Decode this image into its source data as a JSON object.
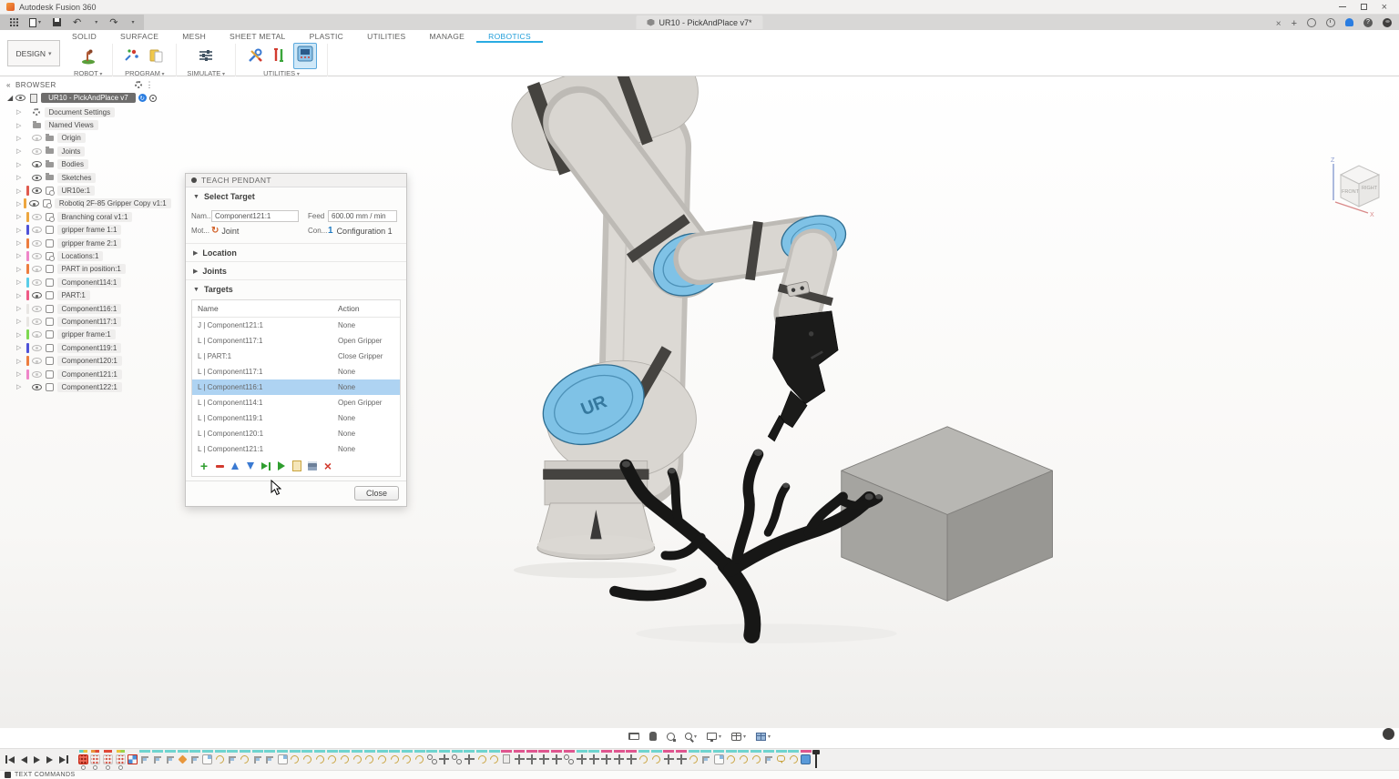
{
  "titlebar": {
    "app_title": "Autodesk Fusion 360"
  },
  "tabbar": {
    "document_tab": "UR10 - PickAndPlace v7*"
  },
  "ribbon": {
    "workspace_label": "DESIGN",
    "tabs": [
      {
        "label": "SOLID"
      },
      {
        "label": "SURFACE"
      },
      {
        "label": "MESH"
      },
      {
        "label": "SHEET METAL"
      },
      {
        "label": "PLASTIC"
      },
      {
        "label": "UTILITIES"
      },
      {
        "label": "MANAGE"
      },
      {
        "label": "ROBOTICS",
        "active": true
      }
    ],
    "groups": [
      {
        "label": "ROBOT"
      },
      {
        "label": "PROGRAM"
      },
      {
        "label": "SIMULATE"
      },
      {
        "label": "UTILITIES"
      }
    ]
  },
  "browser": {
    "header": "BROWSER",
    "root_label": "UR10 - PickAndPlace v7",
    "items": [
      {
        "label": "Document Settings",
        "icon": "gear",
        "eye": "none",
        "color": null
      },
      {
        "label": "Named Views",
        "icon": "folder",
        "eye": "none",
        "color": null
      },
      {
        "label": "Origin",
        "icon": "folder",
        "eye": "hidden",
        "color": null
      },
      {
        "label": "Joints",
        "icon": "folder",
        "eye": "hidden",
        "color": null
      },
      {
        "label": "Bodies",
        "icon": "folder",
        "eye": "visible",
        "color": null
      },
      {
        "label": "Sketches",
        "icon": "folder",
        "eye": "visible",
        "color": null
      },
      {
        "label": "UR10e:1",
        "icon": "link",
        "eye": "visible",
        "color": "#e05a4e"
      },
      {
        "label": "Robotiq 2F-85 Gripper Copy v1:1",
        "icon": "link",
        "eye": "visible",
        "color": "#eda63f"
      },
      {
        "label": "Branching coral v1:1",
        "icon": "link",
        "eye": "hidden",
        "color": "#eda63f"
      },
      {
        "label": "gripper frame 1:1",
        "icon": "comp",
        "eye": "hidden",
        "color": "#4f52d8"
      },
      {
        "label": "gripper frame 2:1",
        "icon": "comp",
        "eye": "hidden",
        "color": "#ed7d3f"
      },
      {
        "label": "Locations:1",
        "icon": "link",
        "eye": "hidden",
        "color": "#ef86c9"
      },
      {
        "label": "PART in position:1",
        "icon": "comp",
        "eye": "hidden",
        "color": "#ed7d3f"
      },
      {
        "label": "Component114:1",
        "icon": "comp",
        "eye": "hidden",
        "color": "#59cde8"
      },
      {
        "label": "PART:1",
        "icon": "comp",
        "eye": "visible",
        "color": "#ef5a86"
      },
      {
        "label": "Component116:1",
        "icon": "comp",
        "eye": "hidden",
        "color": "#e8e6e3"
      },
      {
        "label": "Component117:1",
        "icon": "comp",
        "eye": "hidden",
        "color": "#e8e6e3"
      },
      {
        "label": "gripper frame:1",
        "icon": "comp",
        "eye": "hidden",
        "color": "#7ed952"
      },
      {
        "label": "Component119:1",
        "icon": "comp",
        "eye": "hidden",
        "color": "#4f52d8"
      },
      {
        "label": "Component120:1",
        "icon": "comp",
        "eye": "hidden",
        "color": "#ed7d3f"
      },
      {
        "label": "Component121:1",
        "icon": "comp",
        "eye": "hidden",
        "color": "#ef86c9"
      },
      {
        "label": "Component122:1",
        "icon": "comp",
        "eye": "visible",
        "color": null
      }
    ]
  },
  "viewcube": {
    "front": "FRONT",
    "right": "RIGHT",
    "z": "Z",
    "x": "X"
  },
  "dialog": {
    "title": "TEACH PENDANT",
    "select_target_label": "Select Target",
    "fields": {
      "name_label": "Nam...",
      "name_value": "Component121:1",
      "feed_label": "Feed",
      "feed_value": "600.00 mm / min",
      "motion_label": "Mot...",
      "motion_value": "Joint",
      "config_label": "Con...",
      "config_badge": "1",
      "config_value": "Configuration 1"
    },
    "location_label": "Location",
    "joints_label": "Joints",
    "targets_label": "Targets",
    "table": {
      "columns": [
        "Name",
        "Action"
      ],
      "rows": [
        {
          "name": "J | Component121:1",
          "action": "None"
        },
        {
          "name": "L | Component117:1",
          "action": "Open Gripper"
        },
        {
          "name": "L | PART:1",
          "action": "Close Gripper"
        },
        {
          "name": "L | Component117:1",
          "action": "None"
        },
        {
          "name": "L | Component116:1",
          "action": "None",
          "selected": true
        },
        {
          "name": "L | Component114:1",
          "action": "Open Gripper"
        },
        {
          "name": "L | Component119:1",
          "action": "None"
        },
        {
          "name": "L | Component120:1",
          "action": "None"
        },
        {
          "name": "L | Component121:1",
          "action": "None"
        }
      ]
    },
    "toolbar": [
      {
        "name": "add-target",
        "type": "add"
      },
      {
        "name": "remove-target",
        "type": "remove"
      },
      {
        "name": "move-target-up",
        "type": "up"
      },
      {
        "name": "move-target-down",
        "type": "down"
      },
      {
        "name": "step-to-target",
        "type": "step"
      },
      {
        "name": "play-targets",
        "type": "play"
      },
      {
        "name": "copy-target",
        "type": "copy"
      },
      {
        "name": "save-targets",
        "type": "save"
      },
      {
        "name": "delete-all-targets",
        "type": "delete"
      }
    ],
    "close_label": "Close"
  },
  "navbar": {
    "icons": [
      {
        "name": "view-capture",
        "drop": false
      },
      {
        "name": "pan-hand",
        "drop": false
      },
      {
        "name": "orbit",
        "drop": false
      },
      {
        "name": "zoom",
        "drop": true
      },
      {
        "name": "display-settings",
        "drop": true
      },
      {
        "name": "grid-snaps",
        "drop": true
      },
      {
        "name": "viewports",
        "drop": true
      }
    ]
  },
  "timeline": {
    "icons": [
      {
        "t": "jointsel",
        "b": "m1",
        "d": 1
      },
      {
        "t": "joint",
        "b": "m2",
        "d": 1
      },
      {
        "t": "joint",
        "b": "m3",
        "d": 1
      },
      {
        "t": "joint",
        "b": "m4",
        "d": 1
      },
      {
        "t": "compsel",
        "b": "n"
      },
      {
        "t": "flag",
        "b": "c"
      },
      {
        "t": "flag",
        "b": "c"
      },
      {
        "t": "flag",
        "b": "c"
      },
      {
        "t": "pin",
        "b": "c"
      },
      {
        "t": "flag",
        "b": "c"
      },
      {
        "t": "comp",
        "b": "c"
      },
      {
        "t": "circ",
        "b": "c"
      },
      {
        "t": "flag",
        "b": "c"
      },
      {
        "t": "circ",
        "b": "c"
      },
      {
        "t": "flag",
        "b": "c"
      },
      {
        "t": "flag",
        "b": "c"
      },
      {
        "t": "comp",
        "b": "c"
      },
      {
        "t": "circ",
        "b": "c"
      },
      {
        "t": "circ",
        "b": "c"
      },
      {
        "t": "circ",
        "b": "c"
      },
      {
        "t": "circ",
        "b": "c"
      },
      {
        "t": "circ",
        "b": "c"
      },
      {
        "t": "circ",
        "b": "c"
      },
      {
        "t": "circ",
        "b": "c"
      },
      {
        "t": "circ",
        "b": "c"
      },
      {
        "t": "circ",
        "b": "c"
      },
      {
        "t": "circ",
        "b": "c"
      },
      {
        "t": "circ",
        "b": "c"
      },
      {
        "t": "link",
        "b": "c"
      },
      {
        "t": "move",
        "b": "c"
      },
      {
        "t": "link",
        "b": "c"
      },
      {
        "t": "move",
        "b": "c"
      },
      {
        "t": "circ",
        "b": "c"
      },
      {
        "t": "circ",
        "b": "c"
      },
      {
        "t": "doc",
        "b": "p"
      },
      {
        "t": "move",
        "b": "p"
      },
      {
        "t": "move",
        "b": "p"
      },
      {
        "t": "move",
        "b": "p"
      },
      {
        "t": "move",
        "b": "p"
      },
      {
        "t": "link",
        "b": "p"
      },
      {
        "t": "move",
        "b": "c"
      },
      {
        "t": "move",
        "b": "c"
      },
      {
        "t": "move",
        "b": "p"
      },
      {
        "t": "move",
        "b": "p"
      },
      {
        "t": "move",
        "b": "p"
      },
      {
        "t": "circ",
        "b": "c"
      },
      {
        "t": "circ",
        "b": "c"
      },
      {
        "t": "move",
        "b": "p"
      },
      {
        "t": "move",
        "b": "p"
      },
      {
        "t": "circ",
        "b": "c"
      },
      {
        "t": "flag",
        "b": "c"
      },
      {
        "t": "comp",
        "b": "c"
      },
      {
        "t": "circ",
        "b": "c"
      },
      {
        "t": "circ",
        "b": "c"
      },
      {
        "t": "circ",
        "b": "c"
      },
      {
        "t": "flag",
        "b": "c"
      },
      {
        "t": "chat",
        "b": "c"
      },
      {
        "t": "circ",
        "b": "c"
      },
      {
        "t": "compblue",
        "b": "p"
      }
    ]
  },
  "statusbar": {
    "label": "TEXT COMMANDS"
  },
  "colors": {
    "accent_blue": "#1f9dd9",
    "selection_blue": "#aed3f2",
    "timeline_cyan": "#6ed4cf",
    "timeline_pink": "#e0568f",
    "robot_blue": "#7fc2e6"
  }
}
